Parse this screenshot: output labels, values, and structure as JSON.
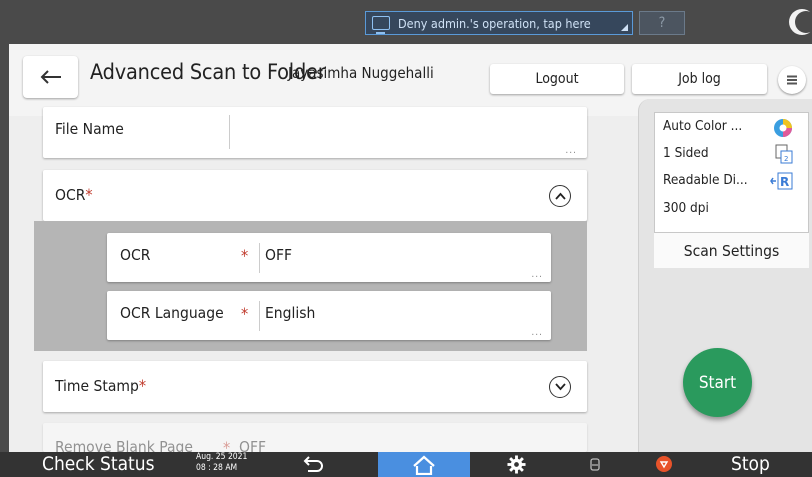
{
  "system": {
    "deny_text": "Deny admin.'s operation, tap here",
    "help_label": "?"
  },
  "header": {
    "title": "Advanced Scan to Folder",
    "user": "Jayasimha Nuggehalli",
    "logout_label": "Logout",
    "joblog_label": "Job log"
  },
  "fields": {
    "file_name_label": "File Name",
    "ocr_section_label": "OCR",
    "ocr_label": "OCR",
    "ocr_value": "OFF",
    "ocr_language_label": "OCR Language",
    "ocr_language_value": "English",
    "time_stamp_label": "Time Stamp",
    "remove_blank_label": "Remove Blank Page",
    "remove_blank_value": "OFF",
    "required_mark": "*",
    "more_dots": "..."
  },
  "scan_summary": {
    "color": "Auto Color ...",
    "sided": "1 Sided",
    "orientation": "Readable Di...",
    "resolution": "300 dpi",
    "button_label": "Scan Settings"
  },
  "start_label": "Start",
  "bottom_bar": {
    "check_status": "Check Status",
    "date": "Aug. 25 2021",
    "time": "08 : 28 AM",
    "stop_label": "Stop"
  },
  "colors": {
    "start": "#2a9a5d",
    "home_tab": "#4a8fe0",
    "required": "#c0392b"
  }
}
